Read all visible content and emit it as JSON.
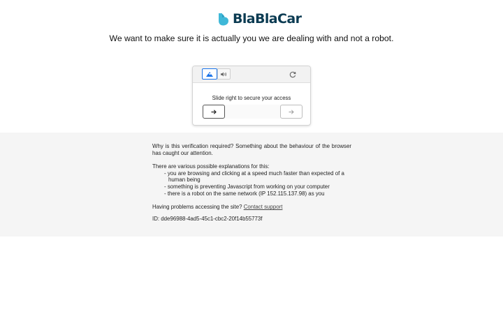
{
  "brand": {
    "name": "BlaBlaCar",
    "color": "#0b3b52",
    "accent": "#3fb8d8"
  },
  "headline": "We want to make sure it is actually you we are dealing with and not a robot.",
  "captcha": {
    "tabs": [
      {
        "name": "image-challenge",
        "icon": "mountain-icon",
        "selected": true
      },
      {
        "name": "audio-challenge",
        "icon": "speaker-icon",
        "selected": false
      }
    ],
    "refresh_icon": "refresh-icon",
    "instruction": "Slide right to secure your access",
    "slider_handle_icon": "arrow-right-icon",
    "slider_target_icon": "arrow-right-icon"
  },
  "info": {
    "why": "Why is this verification required? Something about the behaviour of the browser has caught our attention.",
    "explanations_intro": "There are various possible explanations for this:",
    "explanations": [
      "- you are browsing and clicking at a speed much faster than expected of a human being",
      "- something is preventing Javascript from working on your computer",
      "- there is a robot on the same network (IP 152.115.137.98) as you"
    ],
    "help_text": "Having problems accessing the site?",
    "contact_link": "Contact support",
    "id_text": "ID: dde96988-4ad5-45c1-cbc2-20f14b55773f"
  }
}
